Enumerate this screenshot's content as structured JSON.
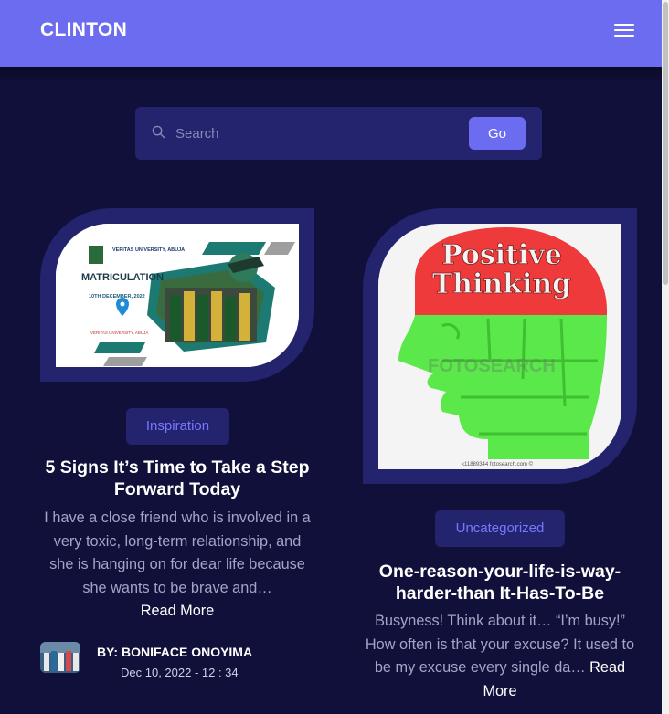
{
  "header": {
    "brand": "CLINTON",
    "menu_icon": "hamburger-menu-icon"
  },
  "search": {
    "placeholder": "Search",
    "button_label": "Go",
    "icon": "search-icon"
  },
  "colors": {
    "header_bg": "#6c6cf0",
    "page_bg": "#10103a",
    "card_bg": "#23236e",
    "accent": "#7777ff"
  },
  "posts": [
    {
      "category": "Inspiration",
      "title": "5 Signs It’s Time to Take a Step Forward Today",
      "excerpt": "I have a close friend who is involved in a very toxic, long-term relationship, and she is hanging on for dear life because she wants to be brave and…",
      "read_more": "Read More",
      "author": "BY: BONIFACE ONOYIMA",
      "date": "Dec 10, 2022 - 12 : 34",
      "image": {
        "heading": "VERITAS UNIVERSITY, ABUJA",
        "title": "MATRICULATION",
        "date": "10TH DECEMBER, 2022",
        "location": "VERITAS UNIVERSITY, ABUJA"
      }
    },
    {
      "category": "Uncategorized",
      "title": "One-reason-your-life-is-way-harder-than It-Has-To-Be",
      "excerpt_before": "Busyness! Think about it… “I’m busy!” How often is that your excuse? It used to be my excuse every single da…",
      "read_more": "Read More",
      "image": {
        "line1": "Positive",
        "line2": "Thinking",
        "watermark": "FOTOSEARCH",
        "caption": "k11889344 fotosearch.com ©"
      }
    }
  ]
}
